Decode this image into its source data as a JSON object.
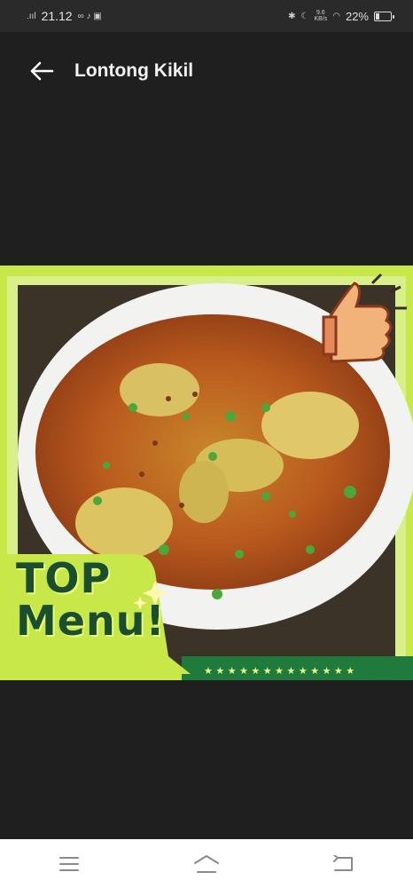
{
  "status": {
    "time": "21.12",
    "network_speed": "9.6\nKB/s",
    "battery": "22%"
  },
  "header": {
    "title": "Lontong Kikil",
    "back_icon": "back-arrow-icon"
  },
  "image": {
    "badge_line1": "TOP",
    "badge_line2": "Menu!",
    "thumbs_icon": "thumbs-up-icon"
  },
  "nav": {
    "items": [
      "menu-icon",
      "home-icon",
      "back-icon"
    ]
  },
  "colors": {
    "background": "#1f1f1f",
    "frame_green": "#c8e84a",
    "badge_dark_green": "#1b4e2f"
  }
}
